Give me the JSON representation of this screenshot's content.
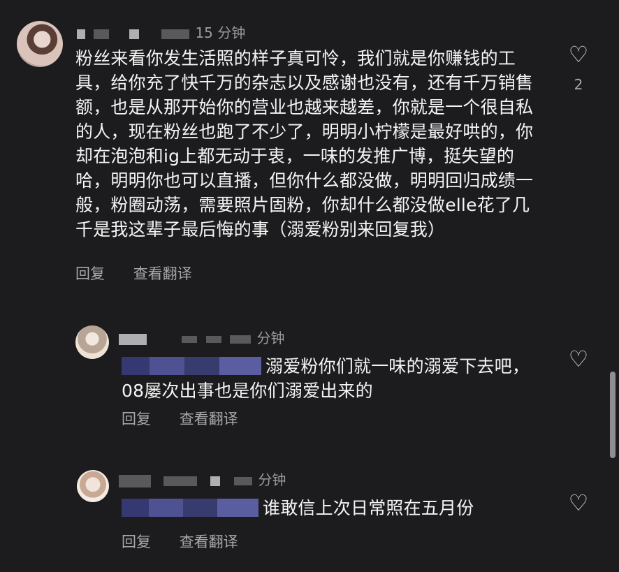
{
  "main_comment": {
    "time": "15 分钟",
    "text": "粉丝来看你发生活照的样子真可怜，我们就是你赚钱的工具，给你充了快千万的杂志以及感谢也没有，还有千万销售额，也是从那开始你的营业也越来越差，你就是一个很自私的人，现在粉丝也跑了不少了，明明小柠檬是最好哄的，你却在泡泡和ig上都无动于衷，一味的发推广博，挺失望的哈，明明你也可以直播，但你什么都没做，明明回归成绩一般，粉圈动荡，需要照片固粉，你却什么都没做elle花了几千是我这辈子最后悔的事（溺爱粉别来回复我）",
    "reply_label": "回复",
    "translate_label": "查看翻译",
    "like_count": "2"
  },
  "replies": [
    {
      "time": "分钟",
      "text": "溺爱粉你们就一味的溺爱下去吧，08屡次出事也是你们溺爱出来的",
      "reply_label": "回复",
      "translate_label": "查看翻译"
    },
    {
      "time": "分钟",
      "text": "谁敢信上次日常照在五月份",
      "reply_label": "回复",
      "translate_label": "查看翻译"
    }
  ],
  "icons": {
    "heart": "heart-outline-icon"
  }
}
